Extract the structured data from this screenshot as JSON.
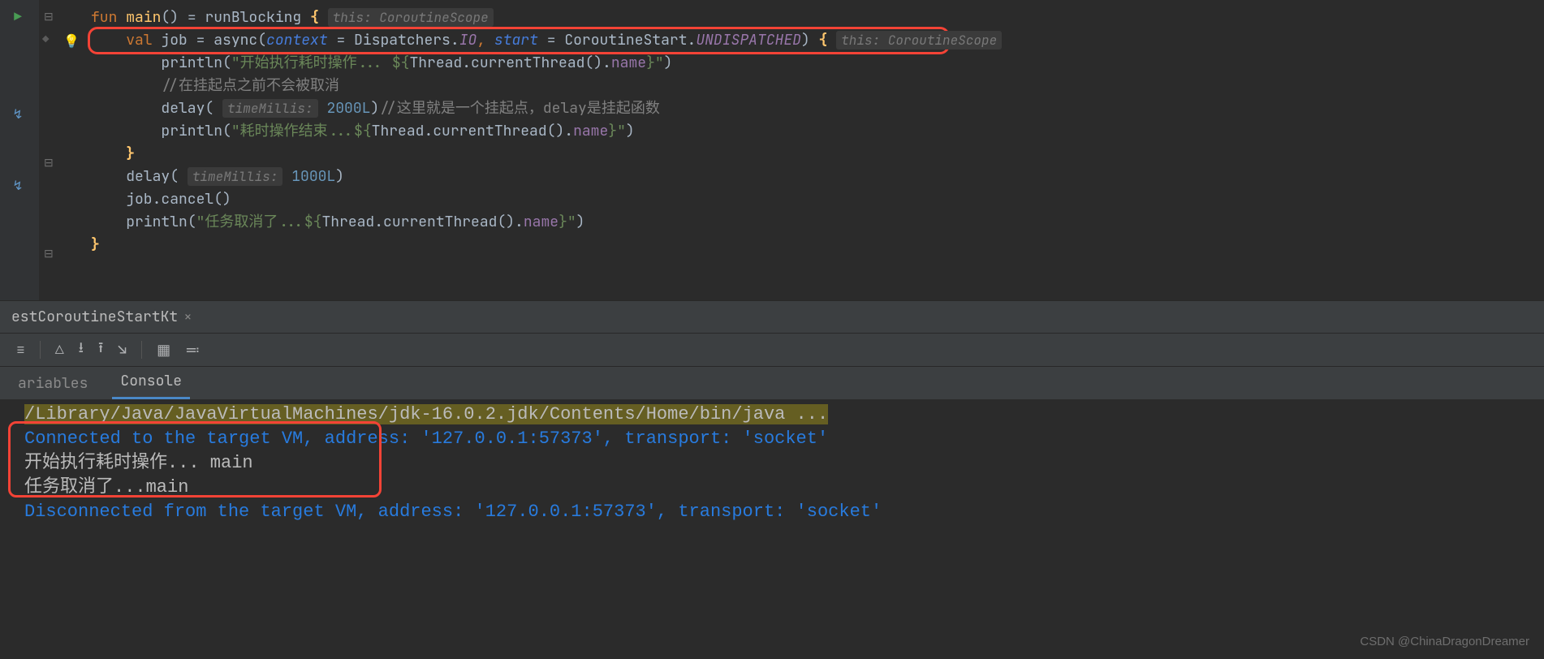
{
  "code": {
    "line1": {
      "fun": "fun",
      "main": "main",
      "eq": "= ",
      "runBlocking": "runBlocking",
      "brace": "{",
      "hint": "this: CoroutineScope"
    },
    "line2": {
      "val": "val",
      "job": "job",
      "eq": " = ",
      "async": "async",
      "context": "context",
      "eqArg": " = ",
      "disp": "Dispatchers",
      "dot": ".",
      "io": "IO",
      "comma": ", ",
      "start": "start",
      "corstart": "CoroutineStart",
      "undisp": "UNDISPATCHED",
      "brace": "{",
      "hint": "this: CoroutineScope"
    },
    "line3": {
      "println": "println",
      "str": "\"开始执行耗时操作... ${",
      "thread": "Thread",
      "current": ".currentThread().",
      "name": "name",
      "strend": "}\""
    },
    "line4": {
      "comment": "//在挂起点之前不会被取消"
    },
    "line5": {
      "delay": "delay",
      "hint": "timeMillis:",
      "val": "2000L",
      "comment": "//这里就是一个挂起点，delay是挂起函数"
    },
    "line6": {
      "println": "println",
      "str": "\"耗时操作结束...${",
      "thread": "Thread",
      "current": ".currentThread().",
      "name": "name",
      "strend": "}\""
    },
    "line7": {
      "brace": "}"
    },
    "line8": {
      "delay": "delay",
      "hint": "timeMillis:",
      "val": "1000L"
    },
    "line9": {
      "job": "job",
      "cancel": ".cancel()"
    },
    "line10": {
      "println": "println",
      "str": "\"任务取消了...${",
      "thread": "Thread",
      "current": ".currentThread().",
      "name": "name",
      "strend": "}\""
    },
    "line11": {
      "brace": "}"
    }
  },
  "tab": {
    "name": "estCoroutineStartKt"
  },
  "subtabs": {
    "variables": "ariables",
    "console": "Console"
  },
  "console": {
    "l1": "/Library/Java/JavaVirtualMachines/jdk-16.0.2.jdk/Contents/Home/bin/java ...",
    "l2": "Connected to the target VM, address: '127.0.0.1:57373', transport: 'socket'",
    "l3": "开始执行耗时操作... main",
    "l4": "任务取消了...main",
    "l5": "Disconnected from the target VM, address: '127.0.0.1:57373', transport: 'socket'"
  },
  "watermark": "CSDN @ChinaDragonDreamer"
}
